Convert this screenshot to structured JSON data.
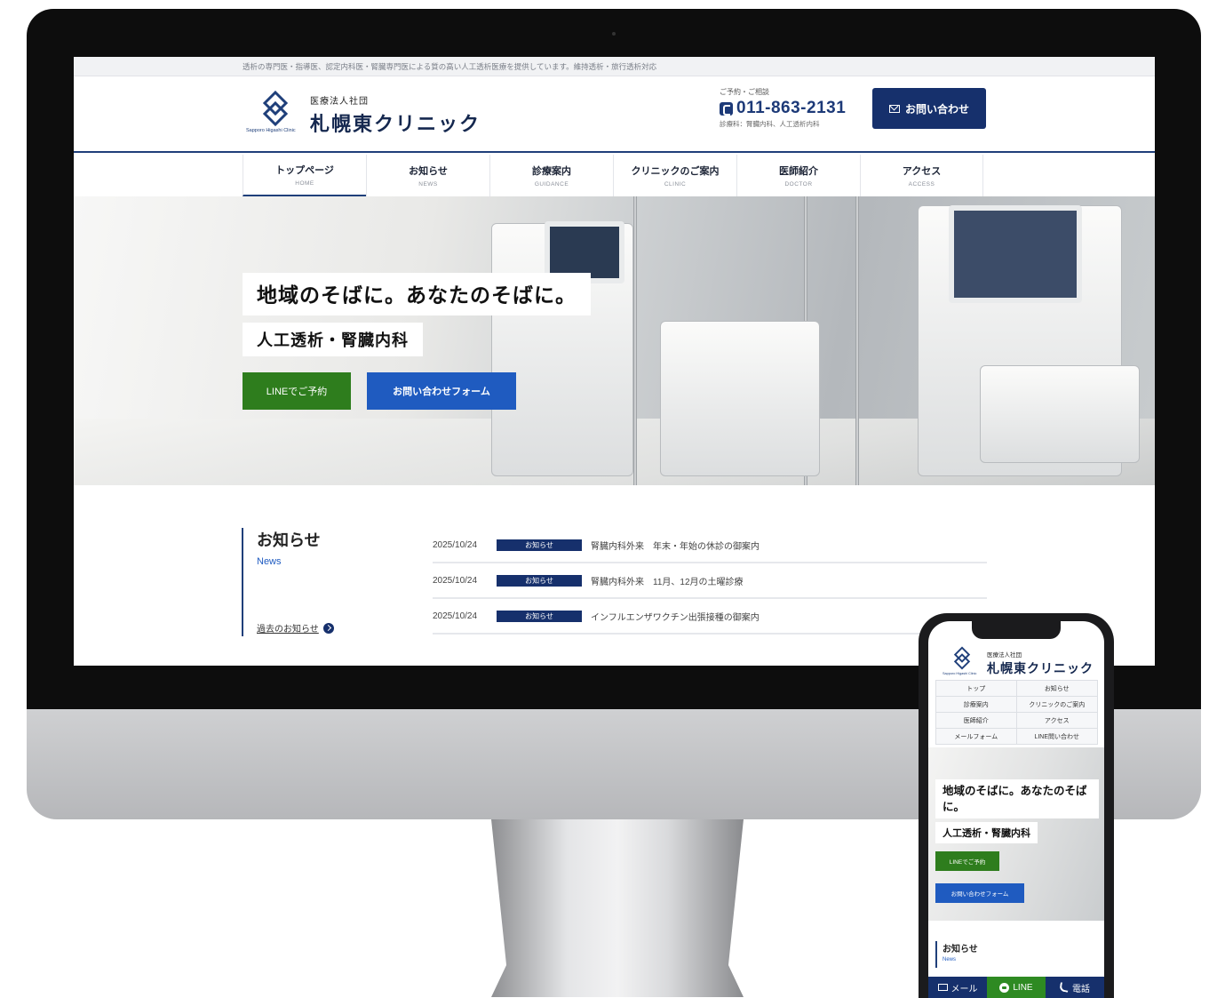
{
  "site": {
    "tagline": "透析の専門医・指導医、認定内科医・腎臓専門医による質の高い人工透析医療を提供しています。維持透析・旅行透析対応",
    "corp_name": "医療法人社団",
    "clinic_name": "札幌東クリニック",
    "clinic_name_en": "Sapporo Higashi Clinic"
  },
  "header": {
    "tel_label": "ご予約・ご相談",
    "tel_number": "011-863-2131",
    "departments": "診療科：腎臓内科、人工透析内科",
    "contact_button": "お問い合わせ"
  },
  "nav": [
    {
      "jp": "トップページ",
      "en": "HOME"
    },
    {
      "jp": "お知らせ",
      "en": "NEWS"
    },
    {
      "jp": "診療案内",
      "en": "GUIDANCE"
    },
    {
      "jp": "クリニックのご案内",
      "en": "CLINIC"
    },
    {
      "jp": "医師紹介",
      "en": "DOCTOR"
    },
    {
      "jp": "アクセス",
      "en": "ACCESS"
    }
  ],
  "hero": {
    "headline": "地域のそばに。あなたのそばに。",
    "subheadline": "人工透析・腎臓内科",
    "line_button": "LINEでご予約",
    "form_button": "お問い合わせフォーム"
  },
  "news": {
    "title": "お知らせ",
    "title_en": "News",
    "past_link": "過去のお知らせ",
    "items": [
      {
        "date": "2025/10/24",
        "category": "お知らせ",
        "title": "腎臓内科外来　年末・年始の休診の御案内"
      },
      {
        "date": "2025/10/24",
        "category": "お知らせ",
        "title": "腎臓内科外来　11月、12月の土曜診療"
      },
      {
        "date": "2025/10/24",
        "category": "お知らせ",
        "title": "インフルエンザワクチン出張接種の御案内"
      }
    ]
  },
  "mobile": {
    "nav": [
      "トップ",
      "お知らせ",
      "診療案内",
      "クリニックのご案内",
      "医師紹介",
      "アクセス",
      "メールフォーム",
      "LINE問い合わせ"
    ],
    "headline": "地域のそばに。あなたのそばに。",
    "subheadline": "人工透析・腎臓内科",
    "line_button": "LINEでご予約",
    "form_button": "お問い合わせフォーム",
    "news_title": "お知らせ",
    "news_en": "News",
    "bottom_bar": {
      "mail": "メール",
      "line": "LINE",
      "tel": "電話"
    }
  },
  "colors": {
    "brand_navy": "#16306c",
    "line_green": "#2e7d1d",
    "form_blue": "#1f5bc0"
  }
}
